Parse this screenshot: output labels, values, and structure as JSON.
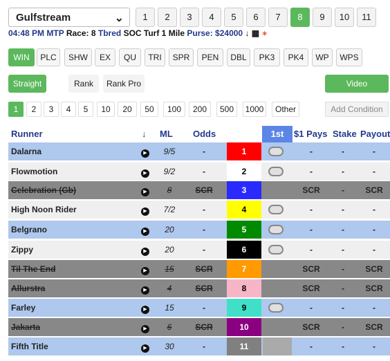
{
  "track": {
    "label": "Gulfstream"
  },
  "races": [
    {
      "label": "1",
      "active": false
    },
    {
      "label": "2",
      "active": false
    },
    {
      "label": "3",
      "active": false
    },
    {
      "label": "4",
      "active": false
    },
    {
      "label": "5",
      "active": false
    },
    {
      "label": "6",
      "active": false
    },
    {
      "label": "7",
      "active": false
    },
    {
      "label": "8",
      "active": true
    },
    {
      "label": "9",
      "active": false
    },
    {
      "label": "10",
      "active": false
    },
    {
      "label": "11",
      "active": false
    }
  ],
  "info": {
    "time": "04:48 PM",
    "mtp": "MTP",
    "race": "Race: 8",
    "breed": "Tbred",
    "desc": "SOC Turf 1 Mile",
    "purse": "Purse: $24000"
  },
  "bet_types": [
    {
      "label": "WIN",
      "active": true
    },
    {
      "label": "PLC",
      "active": false
    },
    {
      "label": "SHW",
      "active": false
    },
    {
      "label": "EX",
      "active": false
    },
    {
      "label": "QU",
      "active": false
    },
    {
      "label": "TRI",
      "active": false
    },
    {
      "label": "SPR",
      "active": false
    },
    {
      "label": "PEN",
      "active": false
    },
    {
      "label": "DBL",
      "active": false
    },
    {
      "label": "PK3",
      "active": false
    },
    {
      "label": "PK4",
      "active": false
    },
    {
      "label": "WP",
      "active": false
    },
    {
      "label": "WPS",
      "active": false
    }
  ],
  "modes": {
    "straight": "Straight",
    "rank": "Rank",
    "rank_pro": "Rank Pro",
    "video": "Video"
  },
  "amounts": [
    {
      "label": "1",
      "active": true
    },
    {
      "label": "2",
      "active": false
    },
    {
      "label": "3",
      "active": false
    },
    {
      "label": "4",
      "active": false
    },
    {
      "label": "5",
      "active": false
    },
    {
      "label": "10",
      "active": false
    },
    {
      "label": "20",
      "active": false
    },
    {
      "label": "50",
      "active": false
    },
    {
      "label": "100",
      "active": false
    },
    {
      "label": "200",
      "active": false
    },
    {
      "label": "500",
      "active": false
    },
    {
      "label": "1000",
      "active": false
    },
    {
      "label": "Other",
      "active": false
    }
  ],
  "add_condition": "Add Condition",
  "headers": {
    "runner": "Runner",
    "sort": "↓",
    "ml": "ML",
    "odds": "Odds",
    "first": "1st",
    "pays": "$1 Pays",
    "stake": "Stake",
    "payout": "Payout"
  },
  "runners": [
    {
      "name": "Dalarna",
      "ml": "9/5",
      "odds": "-",
      "pp": "1",
      "pp_bg": "#ff0000",
      "pp_fg": "#ffffff",
      "scratched": false,
      "pays": "-",
      "stake": "-",
      "payout": "-",
      "row": "blue"
    },
    {
      "name": "Flowmotion",
      "ml": "9/2",
      "odds": "-",
      "pp": "2",
      "pp_bg": "#ffffff",
      "pp_fg": "#000000",
      "scratched": false,
      "pays": "-",
      "stake": "-",
      "payout": "-",
      "row": "light"
    },
    {
      "name": "Celebration (Gb)",
      "ml": "8",
      "odds": "SCR",
      "pp": "3",
      "pp_bg": "#2a2aff",
      "pp_fg": "#ffffff",
      "scratched": true,
      "pays": "SCR",
      "stake": "-",
      "payout": "SCR",
      "row": "scr"
    },
    {
      "name": "High Noon Rider",
      "ml": "7/2",
      "odds": "-",
      "pp": "4",
      "pp_bg": "#ffff00",
      "pp_fg": "#000000",
      "scratched": false,
      "pays": "-",
      "stake": "-",
      "payout": "-",
      "row": "light"
    },
    {
      "name": "Belgrano",
      "ml": "20",
      "odds": "-",
      "pp": "5",
      "pp_bg": "#008a00",
      "pp_fg": "#ffffff",
      "scratched": false,
      "pays": "-",
      "stake": "-",
      "payout": "-",
      "row": "blue"
    },
    {
      "name": "Zippy",
      "ml": "20",
      "odds": "-",
      "pp": "6",
      "pp_bg": "#000000",
      "pp_fg": "#ffffff",
      "scratched": false,
      "pays": "-",
      "stake": "-",
      "payout": "-",
      "row": "light"
    },
    {
      "name": "Til The End",
      "ml": "15",
      "odds": "SCR",
      "pp": "7",
      "pp_bg": "#ff9a00",
      "pp_fg": "#ffffff",
      "scratched": true,
      "pays": "SCR",
      "stake": "-",
      "payout": "SCR",
      "row": "scr"
    },
    {
      "name": "Allurstra",
      "ml": "4",
      "odds": "SCR",
      "pp": "8",
      "pp_bg": "#f7b6c8",
      "pp_fg": "#000000",
      "scratched": true,
      "pays": "SCR",
      "stake": "-",
      "payout": "SCR",
      "row": "scr"
    },
    {
      "name": "Farley",
      "ml": "15",
      "odds": "-",
      "pp": "9",
      "pp_bg": "#40e0c8",
      "pp_fg": "#000000",
      "scratched": false,
      "pays": "-",
      "stake": "-",
      "payout": "-",
      "row": "blue"
    },
    {
      "name": "Jakarta",
      "ml": "6",
      "odds": "SCR",
      "pp": "10",
      "pp_bg": "#8a0080",
      "pp_fg": "#ffffff",
      "scratched": true,
      "pays": "SCR",
      "stake": "-",
      "payout": "SCR",
      "row": "scr"
    },
    {
      "name": "Fifth Title",
      "ml": "30",
      "odds": "-",
      "pp": "11",
      "pp_bg": "#808080",
      "pp_fg": "#ffffff",
      "scratched": true,
      "pays": "-",
      "stake": "-",
      "payout": "-",
      "row": "blue"
    }
  ]
}
